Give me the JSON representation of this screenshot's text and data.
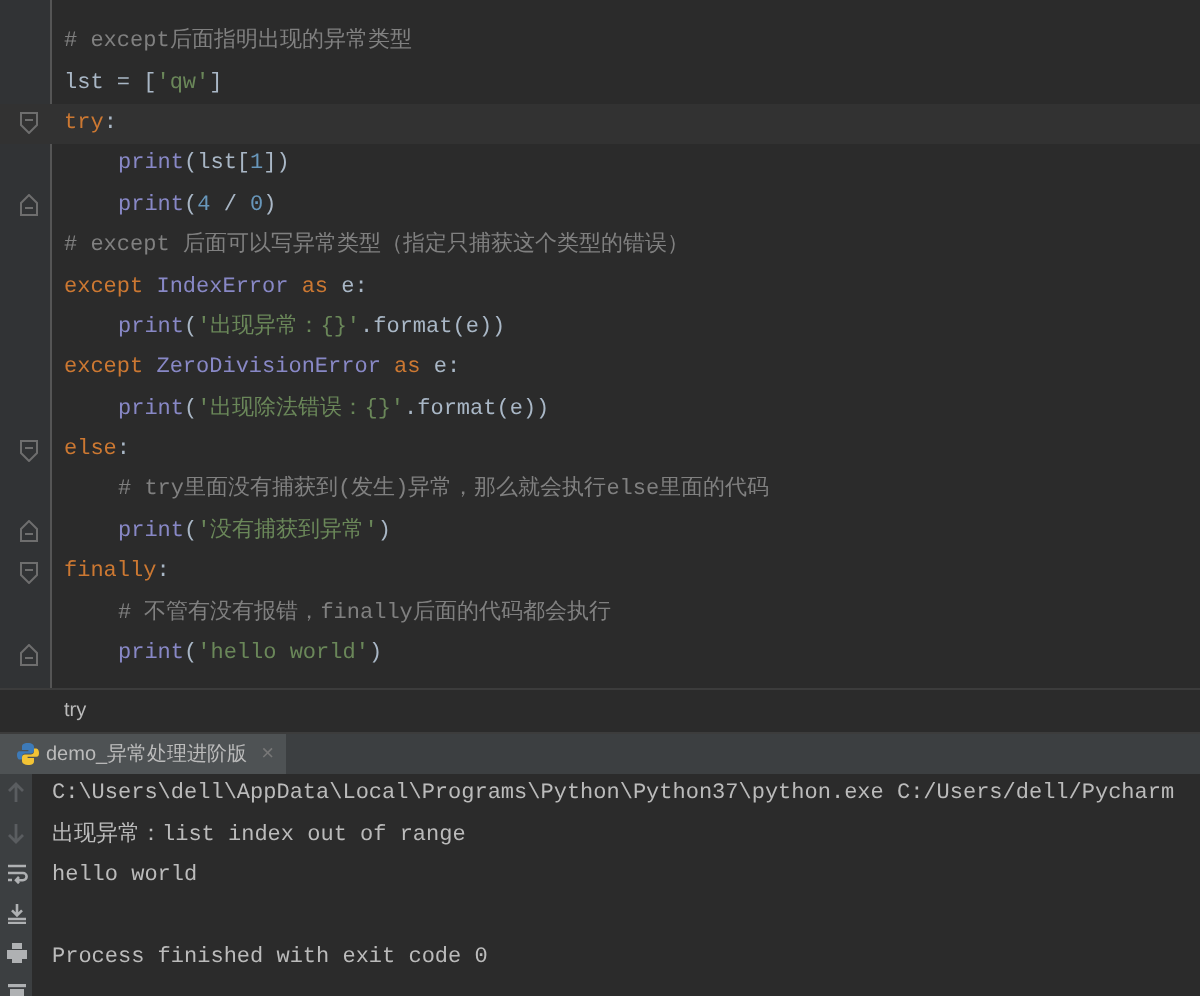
{
  "editor": {
    "lines": [
      {
        "indented": false,
        "fold_start": false,
        "fold_end": false,
        "current": false,
        "tokens": [
          {
            "kind": "comment",
            "text": "# except后面指明出现的异常类型"
          }
        ]
      },
      {
        "indented": false,
        "fold_start": false,
        "fold_end": false,
        "current": false,
        "tokens": [
          {
            "kind": "plain",
            "text": "lst = ["
          },
          {
            "kind": "string",
            "text": "'qw'"
          },
          {
            "kind": "plain",
            "text": "]"
          }
        ]
      },
      {
        "indented": false,
        "fold_start": true,
        "fold_end": false,
        "current": true,
        "tokens": [
          {
            "kind": "keyword",
            "text": "try"
          },
          {
            "kind": "plain",
            "text": ":"
          }
        ]
      },
      {
        "indented": true,
        "fold_start": false,
        "fold_end": false,
        "current": false,
        "tokens": [
          {
            "kind": "builtin",
            "text": "print"
          },
          {
            "kind": "plain",
            "text": "(lst["
          },
          {
            "kind": "number",
            "text": "1"
          },
          {
            "kind": "plain",
            "text": "])"
          }
        ]
      },
      {
        "indented": true,
        "fold_start": false,
        "fold_end": true,
        "current": false,
        "tokens": [
          {
            "kind": "builtin",
            "text": "print"
          },
          {
            "kind": "plain",
            "text": "("
          },
          {
            "kind": "number",
            "text": "4"
          },
          {
            "kind": "plain",
            "text": " / "
          },
          {
            "kind": "number",
            "text": "0"
          },
          {
            "kind": "plain",
            "text": ")"
          }
        ]
      },
      {
        "indented": false,
        "fold_start": false,
        "fold_end": false,
        "current": false,
        "tokens": [
          {
            "kind": "comment",
            "text": "# except 后面可以写异常类型（指定只捕获这个类型的错误）"
          }
        ]
      },
      {
        "indented": false,
        "fold_start": false,
        "fold_end": false,
        "current": false,
        "tokens": [
          {
            "kind": "keyword",
            "text": "except "
          },
          {
            "kind": "builtin",
            "text": "IndexError"
          },
          {
            "kind": "keyword",
            "text": " as "
          },
          {
            "kind": "plain",
            "text": "e:"
          }
        ]
      },
      {
        "indented": true,
        "fold_start": false,
        "fold_end": false,
        "current": false,
        "tokens": [
          {
            "kind": "builtin",
            "text": "print"
          },
          {
            "kind": "plain",
            "text": "("
          },
          {
            "kind": "string",
            "text": "'出现异常：{}'"
          },
          {
            "kind": "plain",
            "text": ".format(e))"
          }
        ]
      },
      {
        "indented": false,
        "fold_start": false,
        "fold_end": false,
        "current": false,
        "tokens": [
          {
            "kind": "keyword",
            "text": "except "
          },
          {
            "kind": "builtin",
            "text": "ZeroDivisionError"
          },
          {
            "kind": "keyword",
            "text": " as "
          },
          {
            "kind": "plain",
            "text": "e:"
          }
        ]
      },
      {
        "indented": true,
        "fold_start": false,
        "fold_end": false,
        "current": false,
        "tokens": [
          {
            "kind": "builtin",
            "text": "print"
          },
          {
            "kind": "plain",
            "text": "("
          },
          {
            "kind": "string",
            "text": "'出现除法错误：{}'"
          },
          {
            "kind": "plain",
            "text": ".format(e))"
          }
        ]
      },
      {
        "indented": false,
        "fold_start": true,
        "fold_end": false,
        "current": false,
        "tokens": [
          {
            "kind": "keyword",
            "text": "else"
          },
          {
            "kind": "plain",
            "text": ":"
          }
        ]
      },
      {
        "indented": true,
        "fold_start": false,
        "fold_end": false,
        "current": false,
        "tokens": [
          {
            "kind": "comment",
            "text": "# try里面没有捕获到(发生)异常，那么就会执行else里面的代码"
          }
        ]
      },
      {
        "indented": true,
        "fold_start": false,
        "fold_end": true,
        "current": false,
        "tokens": [
          {
            "kind": "builtin",
            "text": "print"
          },
          {
            "kind": "plain",
            "text": "("
          },
          {
            "kind": "string",
            "text": "'没有捕获到异常'"
          },
          {
            "kind": "plain",
            "text": ")"
          }
        ]
      },
      {
        "indented": false,
        "fold_start": true,
        "fold_end": false,
        "current": false,
        "tokens": [
          {
            "kind": "keyword",
            "text": "finally"
          },
          {
            "kind": "plain",
            "text": ":"
          }
        ]
      },
      {
        "indented": true,
        "fold_start": false,
        "fold_end": false,
        "current": false,
        "tokens": [
          {
            "kind": "comment",
            "text": "# 不管有没有报错，finally后面的代码都会执行"
          }
        ]
      },
      {
        "indented": true,
        "fold_start": false,
        "fold_end": true,
        "current": false,
        "tokens": [
          {
            "kind": "builtin",
            "text": "print"
          },
          {
            "kind": "plain",
            "text": "("
          },
          {
            "kind": "string",
            "text": "'hello world'"
          },
          {
            "kind": "plain",
            "text": ")"
          }
        ]
      }
    ]
  },
  "breadcrumb": "try",
  "run_tab": {
    "title": "demo_异常处理进阶版",
    "close": "×"
  },
  "console": {
    "lines": [
      {
        "text": "C:\\Users\\dell\\AppData\\Local\\Programs\\Python\\Python37\\python.exe C:/Users/dell/Pycharm",
        "blank_line_before": false
      },
      {
        "text": "出现异常：list index out of range",
        "blank_line_before": false
      },
      {
        "text": "hello world",
        "blank_line_before": false
      },
      {
        "text": "Process finished with exit code 0",
        "blank_line_before": true
      }
    ]
  }
}
